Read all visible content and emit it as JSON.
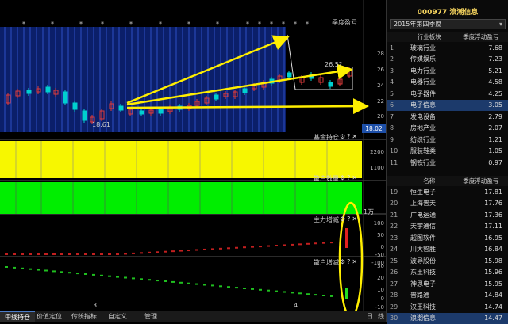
{
  "stock": {
    "code_name": "000977 浪潮信息",
    "season": "2015年第四季度"
  },
  "panels": {
    "main": {
      "title": "季度盈亏",
      "price_ticks": [
        "28",
        "26",
        "24",
        "22",
        "20",
        "18"
      ],
      "price_label": "18.02",
      "low_label": "18.61",
      "high_label": "26.5?"
    },
    "fund": {
      "title": "基金持仓",
      "ticks": [
        "2200",
        "1100"
      ]
    },
    "retail": {
      "title": "散户数量",
      "unit": "1万"
    },
    "main_force": {
      "title": "主力增减",
      "ticks": [
        "100",
        "50",
        "0",
        "-50",
        "-100"
      ]
    },
    "retail_change": {
      "title": "散户增减",
      "ticks": [
        "30",
        "20",
        "10",
        "0",
        "-10"
      ]
    }
  },
  "x_labels": [
    "3",
    "4"
  ],
  "icons": {
    "gear": "⚙",
    "help": "?",
    "close": "✕"
  },
  "sector_table": {
    "headers": [
      "",
      "行业板块",
      "季度浮动盈亏"
    ],
    "rows": [
      {
        "n": "1",
        "name": "玻璃行业",
        "val": "7.68"
      },
      {
        "n": "2",
        "name": "传媒娱乐",
        "val": "7.23"
      },
      {
        "n": "3",
        "name": "电力行业",
        "val": "5.21"
      },
      {
        "n": "4",
        "name": "电器行业",
        "val": "4.58"
      },
      {
        "n": "5",
        "name": "电子器件",
        "val": "4.25"
      },
      {
        "n": "6",
        "name": "电子信息",
        "val": "3.05"
      },
      {
        "n": "7",
        "name": "发电设备",
        "val": "2.79"
      },
      {
        "n": "8",
        "name": "房地产业",
        "val": "2.07"
      },
      {
        "n": "9",
        "name": "纺织行业",
        "val": "1.21"
      },
      {
        "n": "10",
        "name": "服装鞋类",
        "val": "1.05"
      },
      {
        "n": "11",
        "name": "钢铁行业",
        "val": "0.97"
      }
    ]
  },
  "stock_table": {
    "headers": [
      "",
      "名称",
      "季度浮动盈亏"
    ],
    "rows": [
      {
        "n": "19",
        "name": "恒生电子",
        "val": "17.81"
      },
      {
        "n": "20",
        "name": "上海普天",
        "val": "17.76"
      },
      {
        "n": "21",
        "name": "广电运通",
        "val": "17.36"
      },
      {
        "n": "22",
        "name": "天宇通信",
        "val": "17.11"
      },
      {
        "n": "23",
        "name": "超图软件",
        "val": "16.95"
      },
      {
        "n": "24",
        "name": "川大智胜",
        "val": "16.84"
      },
      {
        "n": "25",
        "name": "波导股份",
        "val": "15.98"
      },
      {
        "n": "26",
        "name": "东土科技",
        "val": "15.96"
      },
      {
        "n": "27",
        "name": "神思电子",
        "val": "15.95"
      },
      {
        "n": "28",
        "name": "普路通",
        "val": "14.84"
      },
      {
        "n": "29",
        "name": "汉王科技",
        "val": "14.74"
      },
      {
        "n": "30",
        "name": "浪潮信息",
        "val": "14.47"
      }
    ]
  },
  "tabs": [
    "中线持仓",
    "价值定位",
    "传统指标",
    "自定义",
    "管理"
  ],
  "extra_labels": {
    "day": "日",
    "line": "线"
  },
  "colors": {
    "up": "#e23b3b",
    "down": "#00d0d0",
    "fund": "#f7f700",
    "retail": "#00ee00",
    "accent": "#f4d35e",
    "highlight": "#ffee00"
  }
}
